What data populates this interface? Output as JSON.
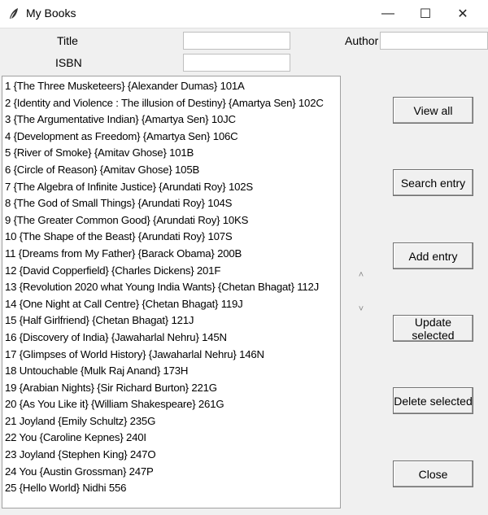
{
  "window": {
    "title": "My Books",
    "minimize_glyph": "—",
    "maximize_glyph": "☐",
    "close_glyph": "✕",
    "icon": "feather-icon"
  },
  "form": {
    "title_label": "Title",
    "isbn_label": "ISBN",
    "author_label": "Author",
    "title_value": "",
    "isbn_value": "",
    "author_value": ""
  },
  "books": [
    "1 {The Three Musketeers} {Alexander Dumas} 101A",
    "2 {Identity and Violence : The illusion of Destiny} {Amartya Sen} 102C",
    "3 {The Argumentative Indian} {Amartya Sen} 10JC",
    "4 {Development as Freedom} {Amartya Sen} 106C",
    "5 {River of Smoke} {Amitav Ghose} 101B",
    "6 {Circle of Reason} {Amitav Ghose} 105B",
    "7 {The Algebra of Infinite Justice} {Arundati Roy} 102S",
    "8 {The God of Small Things} {Arundati Roy} 104S",
    "9 {The Greater Common Good} {Arundati Roy} 10KS",
    "10 {The Shape of the Beast} {Arundati Roy} 107S",
    "11 {Dreams from My Father} {Barack Obama} 200B",
    "12 {David Copperfield} {Charles Dickens} 201F",
    "13 {Revolution 2020 what Young India Wants} {Chetan Bhagat} 112J",
    "14 {One Night at Call Centre} {Chetan Bhagat} 119J",
    "15 {Half Girlfriend} {Chetan Bhagat} 121J",
    "16 {Discovery of India} {Jawaharlal Nehru} 145N",
    "17 {Glimpses of World History} {Jawaharlal Nehru} 146N",
    "18 Untouchable {Mulk Raj Anand} 173H",
    "19 {Arabian Nights} {Sir Richard Burton} 221G",
    "20 {As You Like it} {William Shakespeare} 261G",
    "21 Joyland {Emily Schultz} 235G",
    "22 You {Caroline Kepnes} 240I",
    "23 Joyland {Stephen King} 247O",
    "24 You {Austin Grossman} 247P",
    "25 {Hello World} Nidhi 556"
  ],
  "scrollbar": {
    "up_glyph": "˄",
    "down_glyph": "˅"
  },
  "buttons": {
    "view_all": "View all",
    "search_entry": "Search entry",
    "add_entry": "Add entry",
    "update_selected": "Update selected",
    "delete_selected": "Delete selected",
    "close": "Close"
  }
}
